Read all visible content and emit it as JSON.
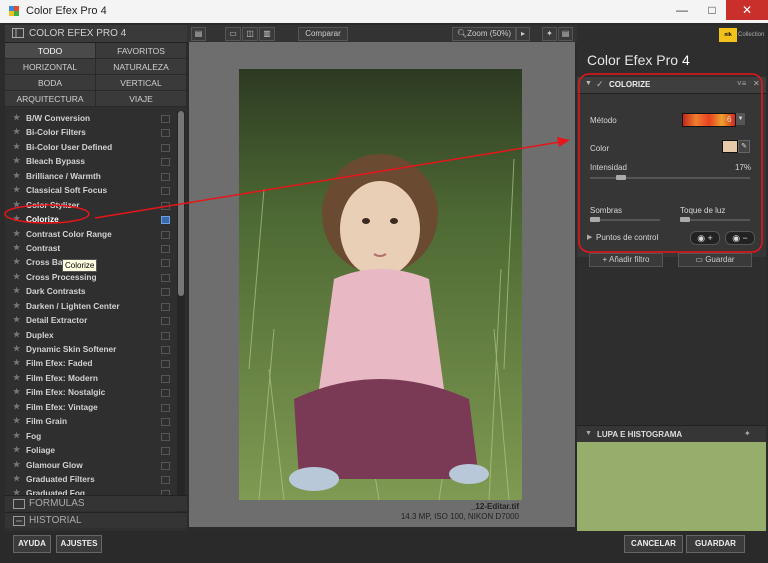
{
  "window": {
    "title": "Color Efex Pro 4",
    "minimize": "—",
    "maximize": "□",
    "close": "✕"
  },
  "left_panel": {
    "header": "COLOR EFEX PRO 4",
    "categories": [
      "TODO",
      "FAVORITOS",
      "HORIZONTAL",
      "NATURALEZA",
      "BODA",
      "VERTICAL",
      "ARQUITECTURA",
      "VIAJE"
    ],
    "selected_category": "TODO",
    "filters": [
      "B/W Conversion",
      "Bi-Color Filters",
      "Bi-Color User Defined",
      "Bleach Bypass",
      "Brilliance / Warmth",
      "Classical Soft Focus",
      "Color Stylizer",
      "Colorize",
      "Contrast Color Range",
      "Contrast",
      "Cross Balance",
      "Cross Processing",
      "Dark Contrasts",
      "Darken / Lighten Center",
      "Detail Extractor",
      "Duplex",
      "Dynamic Skin Softener",
      "Film Efex: Faded",
      "Film Efex: Modern",
      "Film Efex: Nostalgic",
      "Film Efex: Vintage",
      "Film Grain",
      "Fog",
      "Foliage",
      "Glamour Glow",
      "Graduated Filters",
      "Graduated Fog"
    ],
    "selected_filter": "Colorize",
    "tooltip": "Colorize",
    "formulas": "FORMULAS",
    "history": "HISTORIAL"
  },
  "toolbar": {
    "compare": "Comparar",
    "zoom": "Zoom (50%)"
  },
  "image": {
    "filename": "_12-Editar.tif",
    "info": "14.3 MP, ISO 100, NIKON D7000"
  },
  "right_panel": {
    "brand": "Collection",
    "brand_logo": "nik",
    "title": "Color Efex Pro",
    "version": "4",
    "filter_name": "COLORIZE",
    "method_label": "Método",
    "method_value": "6",
    "color_label": "Color",
    "color_value": "#e8c9a9",
    "intensity_label": "Intensidad",
    "intensity_value": "17%",
    "intensity_level": 0.17,
    "shadows_label": "Sombras",
    "highlights_label": "Toque de luz",
    "control_points_label": "Puntos de control",
    "add_filter": "Añadir filtro",
    "save": "Guardar",
    "loupe_header": "LUPA E HISTOGRAMA"
  },
  "bottom": {
    "help": "AYUDA",
    "settings": "AJUSTES",
    "cancel": "CANCELAR",
    "save": "GUARDAR"
  },
  "colors": {
    "annotation": "#e8151a",
    "panel_dark": "#2b2b2b",
    "selected_blue": "#3a6aa8"
  }
}
